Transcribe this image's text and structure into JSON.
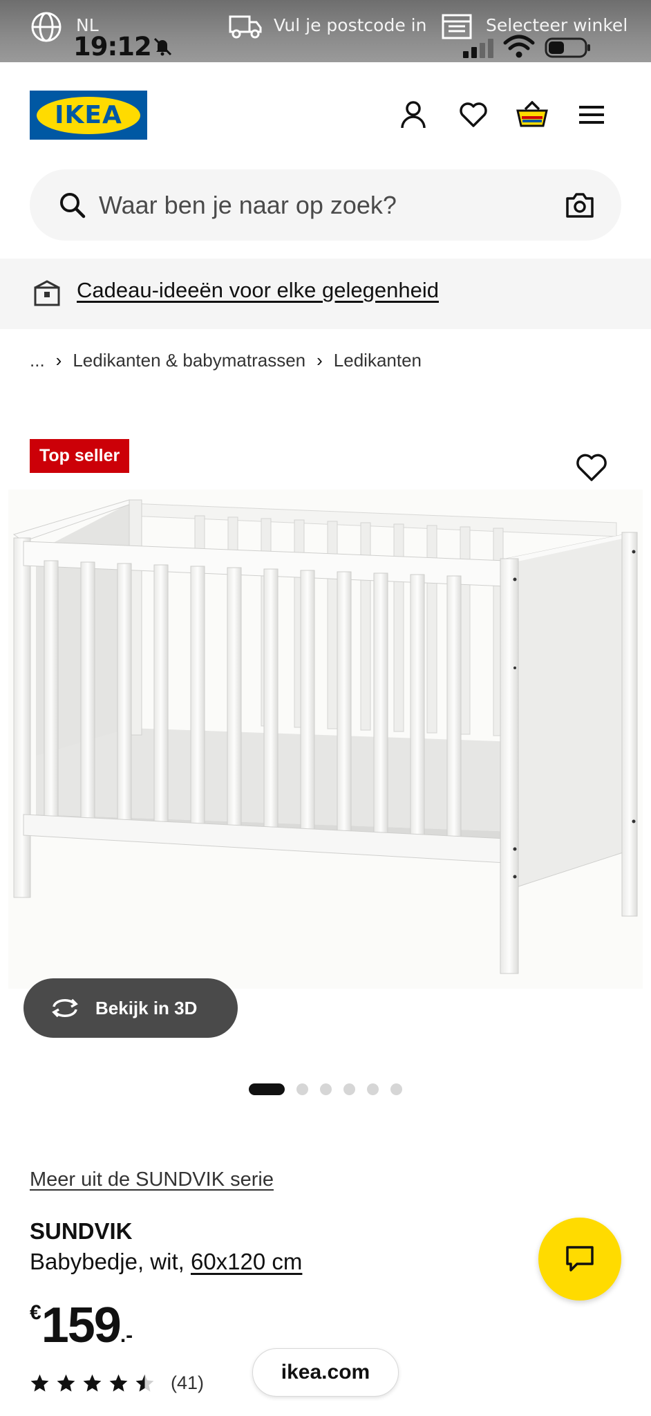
{
  "status_bar": {
    "language": "NL",
    "time": "19:12",
    "postcode_label": "Vul je postcode in",
    "store_label": "Selecteer winkel"
  },
  "header": {
    "logo_text": "IKEA",
    "icons": [
      "account-icon",
      "wishlist-icon",
      "cart-icon",
      "menu-icon"
    ]
  },
  "search": {
    "placeholder": "Waar ben je naar op zoek?"
  },
  "promo": {
    "link_text": "Cadeau-ideeën voor elke gelegenheid"
  },
  "breadcrumb": {
    "items": [
      "...",
      "Ledikanten & babymatrassen",
      "Ledikanten"
    ]
  },
  "product": {
    "badge": "Top seller",
    "view_3d_label": "Bekijk in 3D",
    "carousel": {
      "total": 6,
      "active": 1
    },
    "series_link": "Meer uit de SUNDVIK serie",
    "name": "SUNDVIK",
    "description": "Babybedje, wit, ",
    "size": "60x120 cm",
    "price": {
      "currency": "€",
      "integer": "159",
      "decimal": ".-"
    },
    "rating": {
      "stars": 4.5,
      "count_text": "(41)"
    }
  },
  "browser": {
    "url": "ikea.com"
  },
  "colors": {
    "ikea_blue": "#0058a3",
    "ikea_yellow": "#ffdb00",
    "badge_red": "#cc0008"
  }
}
